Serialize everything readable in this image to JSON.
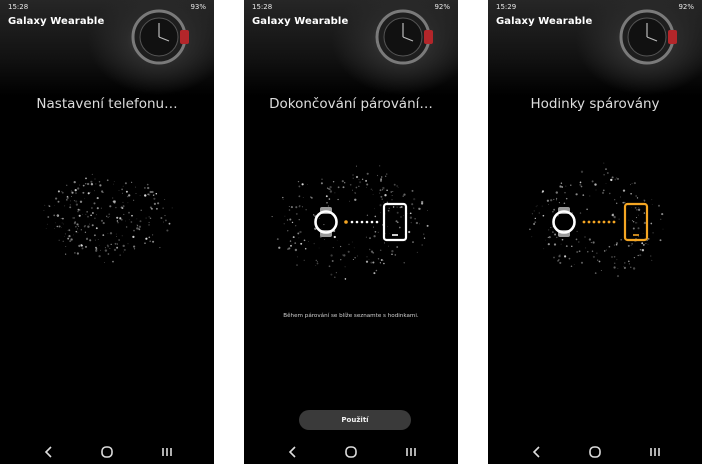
{
  "colors": {
    "background": "#000000",
    "accent_orange": "#f5a623",
    "icon_white": "#ffffff",
    "text_gray": "#dddddd",
    "button_gray": "#3a3a3a"
  },
  "screens": [
    {
      "status": {
        "time": "15:28",
        "right": "93%"
      },
      "app_title": "Galaxy Wearable",
      "heading": "Nastavení telefonu…",
      "nav": {
        "back_icon": "chevron-left-icon",
        "home_icon": "home-circle-icon",
        "recent_icon": "recent-apps-icon"
      }
    },
    {
      "status": {
        "time": "15:28",
        "right": "92%"
      },
      "app_title": "Galaxy Wearable",
      "heading": "Dokončování párování…",
      "caption": "Během párování se blíže seznamte s hodinkami.",
      "button_label": "Použití",
      "nav": {
        "back_icon": "chevron-left-icon",
        "home_icon": "home-circle-icon",
        "recent_icon": "recent-apps-icon"
      }
    },
    {
      "status": {
        "time": "15:29",
        "right": "92%"
      },
      "app_title": "Galaxy Wearable",
      "heading": "Hodinky spárovány",
      "nav": {
        "back_icon": "chevron-left-icon",
        "home_icon": "home-circle-icon",
        "recent_icon": "recent-apps-icon"
      }
    }
  ]
}
